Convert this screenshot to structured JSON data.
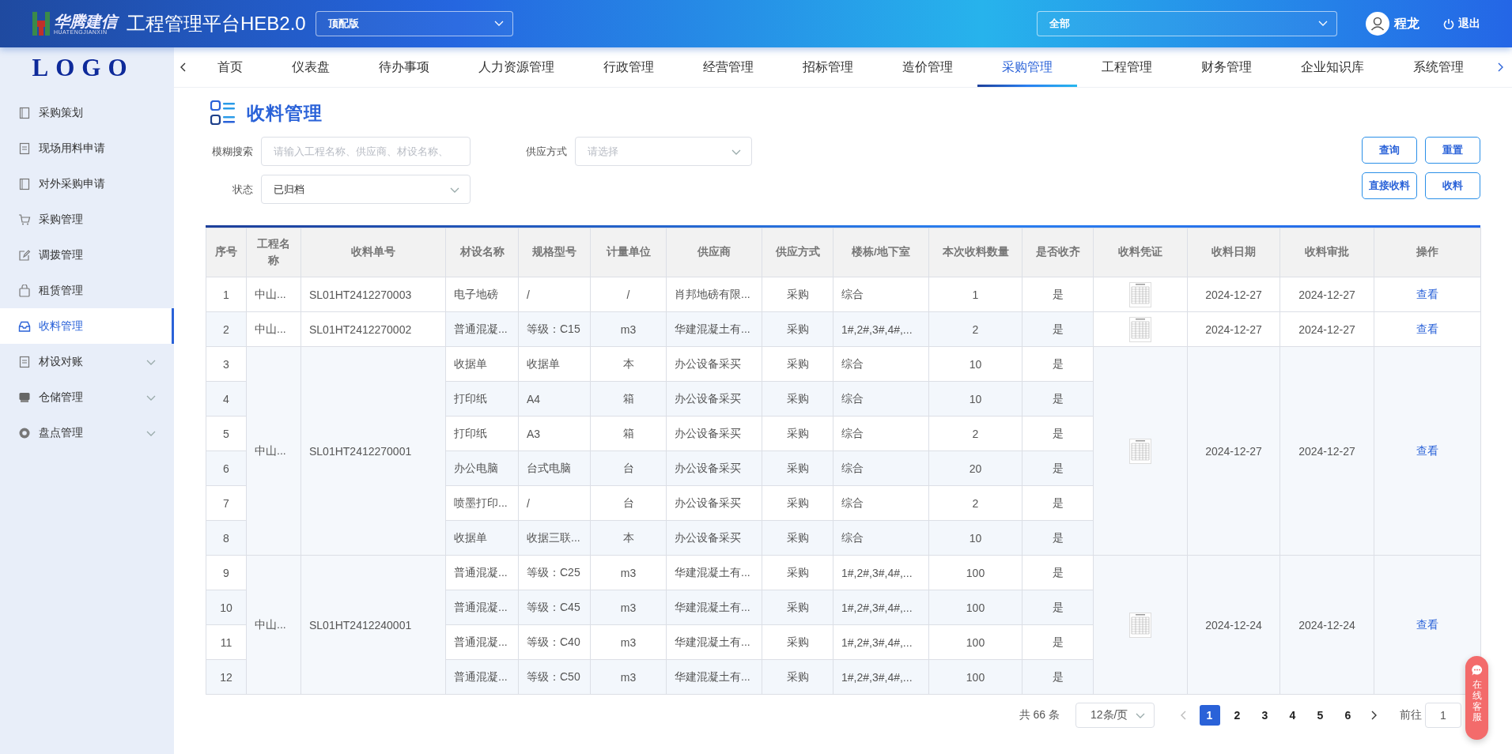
{
  "header": {
    "logo_cn": "华腾建信",
    "logo_en": "HUATENGJIANXIN",
    "title": "工程管理平台HEB2.0",
    "edition_select": "顶配版",
    "scope_select": "全部",
    "user": "程龙",
    "logout": "退出"
  },
  "sidebar": {
    "logo": "LOGO",
    "items": [
      {
        "label": "采购策划",
        "kind": "link",
        "selected": false
      },
      {
        "label": "现场用料申请",
        "kind": "link",
        "selected": false
      },
      {
        "label": "对外采购申请",
        "kind": "link",
        "selected": false
      },
      {
        "label": "采购管理",
        "kind": "link",
        "selected": false
      },
      {
        "label": "调拨管理",
        "kind": "link",
        "selected": false
      },
      {
        "label": "租赁管理",
        "kind": "link",
        "selected": false
      },
      {
        "label": "收料管理",
        "kind": "link",
        "selected": true
      },
      {
        "label": "材设对账",
        "kind": "group",
        "selected": false
      },
      {
        "label": "仓储管理",
        "kind": "group",
        "selected": false
      },
      {
        "label": "盘点管理",
        "kind": "group",
        "selected": false
      }
    ]
  },
  "tabs": [
    {
      "label": "首页",
      "selected": false
    },
    {
      "label": "仪表盘",
      "selected": false
    },
    {
      "label": "待办事项",
      "selected": false
    },
    {
      "label": "人力资源管理",
      "selected": false
    },
    {
      "label": "行政管理",
      "selected": false
    },
    {
      "label": "经营管理",
      "selected": false
    },
    {
      "label": "招标管理",
      "selected": false
    },
    {
      "label": "造价管理",
      "selected": false
    },
    {
      "label": "采购管理",
      "selected": true
    },
    {
      "label": "工程管理",
      "selected": false
    },
    {
      "label": "财务管理",
      "selected": false
    },
    {
      "label": "企业知识库",
      "selected": false
    },
    {
      "label": "系统管理",
      "selected": false
    }
  ],
  "page": {
    "title": "收料管理"
  },
  "filters": {
    "search": {
      "label": "模糊搜索",
      "placeholder": "请输入工程名称、供应商、材设名称、"
    },
    "supply_method": {
      "label": "供应方式",
      "placeholder": "请选择"
    },
    "status": {
      "label": "状态",
      "value": "已归档"
    },
    "buttons": [
      "查询",
      "重置",
      "直接收料",
      "收料"
    ]
  },
  "table": {
    "columns": [
      "序号",
      "工程名称",
      "收料单号",
      "材设名称",
      "规格型号",
      "计量单位",
      "供应商",
      "供应方式",
      "楼栋/地下室",
      "本次收料数量",
      "是否收齐",
      "收料凭证",
      "收料日期",
      "收料审批",
      "操作"
    ],
    "groups": [
      {
        "project": "中山...",
        "receipt_no": "SL01HT2412270003",
        "date": "2024-12-27",
        "approval": "2024-12-27",
        "action": "查看",
        "items": [
          {
            "no": "1",
            "material": "电子地磅",
            "spec": "/",
            "unit": "/",
            "supplier": "肖邦地磅有限...",
            "method": "采购",
            "building": "综合",
            "qty": "1",
            "complete": "是"
          }
        ]
      },
      {
        "project": "中山...",
        "receipt_no": "SL01HT2412270002",
        "date": "2024-12-27",
        "approval": "2024-12-27",
        "action": "查看",
        "items": [
          {
            "no": "2",
            "material": "普通混凝...",
            "spec": "等级：C15",
            "unit": "m3",
            "supplier": "华建混凝土有...",
            "method": "采购",
            "building": "1#,2#,3#,4#,...",
            "qty": "2",
            "complete": "是"
          }
        ]
      },
      {
        "project": "中山...",
        "receipt_no": "SL01HT2412270001",
        "date": "2024-12-27",
        "approval": "2024-12-27",
        "action": "查看",
        "items": [
          {
            "no": "3",
            "material": "收据单",
            "spec": "收据单",
            "unit": "本",
            "supplier": "办公设备采买",
            "method": "采购",
            "building": "综合",
            "qty": "10",
            "complete": "是"
          },
          {
            "no": "4",
            "material": "打印纸",
            "spec": "A4",
            "unit": "箱",
            "supplier": "办公设备采买",
            "method": "采购",
            "building": "综合",
            "qty": "10",
            "complete": "是"
          },
          {
            "no": "5",
            "material": "打印纸",
            "spec": "A3",
            "unit": "箱",
            "supplier": "办公设备采买",
            "method": "采购",
            "building": "综合",
            "qty": "2",
            "complete": "是"
          },
          {
            "no": "6",
            "material": "办公电脑",
            "spec": "台式电脑",
            "unit": "台",
            "supplier": "办公设备采买",
            "method": "采购",
            "building": "综合",
            "qty": "20",
            "complete": "是"
          },
          {
            "no": "7",
            "material": "喷墨打印...",
            "spec": "/",
            "unit": "台",
            "supplier": "办公设备采买",
            "method": "采购",
            "building": "综合",
            "qty": "2",
            "complete": "是"
          },
          {
            "no": "8",
            "material": "收据单",
            "spec": "收据三联...",
            "unit": "本",
            "supplier": "办公设备采买",
            "method": "采购",
            "building": "综合",
            "qty": "10",
            "complete": "是"
          }
        ]
      },
      {
        "project": "中山...",
        "receipt_no": "SL01HT2412240001",
        "date": "2024-12-24",
        "approval": "2024-12-24",
        "action": "查看",
        "items": [
          {
            "no": "9",
            "material": "普通混凝...",
            "spec": "等级：C25",
            "unit": "m3",
            "supplier": "华建混凝土有...",
            "method": "采购",
            "building": "1#,2#,3#,4#,...",
            "qty": "100",
            "complete": "是"
          },
          {
            "no": "10",
            "material": "普通混凝...",
            "spec": "等级：C45",
            "unit": "m3",
            "supplier": "华建混凝土有...",
            "method": "采购",
            "building": "1#,2#,3#,4#,...",
            "qty": "100",
            "complete": "是"
          },
          {
            "no": "11",
            "material": "普通混凝...",
            "spec": "等级：C40",
            "unit": "m3",
            "supplier": "华建混凝土有...",
            "method": "采购",
            "building": "1#,2#,3#,4#,...",
            "qty": "100",
            "complete": "是"
          },
          {
            "no": "12",
            "material": "普通混凝...",
            "spec": "等级：C50",
            "unit": "m3",
            "supplier": "华建混凝土有...",
            "method": "采购",
            "building": "1#,2#,3#,4#,...",
            "qty": "100",
            "complete": "是"
          }
        ]
      }
    ]
  },
  "pagination": {
    "total": "共 66 条",
    "page_size": "12条/页",
    "pages": [
      {
        "label": "1",
        "selected": true
      },
      {
        "label": "2",
        "selected": false
      },
      {
        "label": "3",
        "selected": false
      },
      {
        "label": "4",
        "selected": false
      },
      {
        "label": "5",
        "selected": false
      },
      {
        "label": "6",
        "selected": false
      }
    ],
    "goto_label": "前往",
    "goto_value": "1"
  },
  "chat_button": {
    "label": "在线客服"
  }
}
